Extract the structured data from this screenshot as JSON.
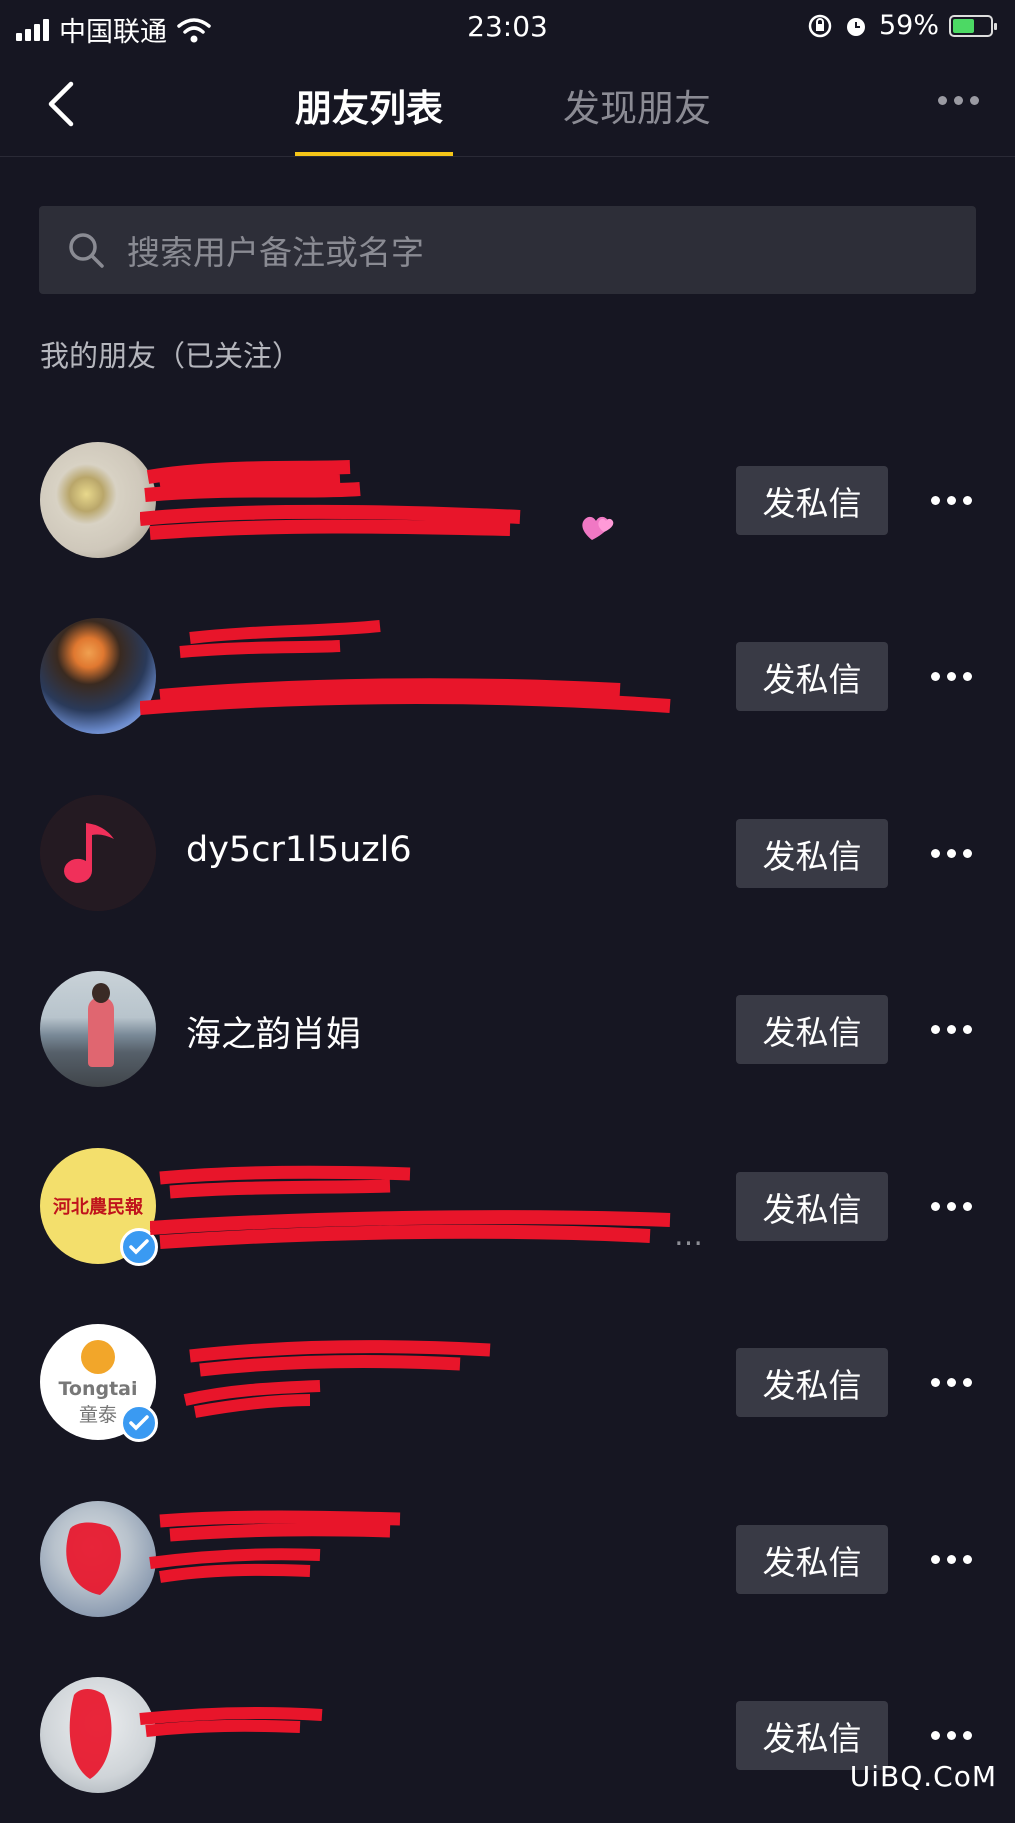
{
  "status_bar": {
    "carrier": "中国联通",
    "time": "23:03",
    "battery": "59%",
    "battery_level": 0.59
  },
  "header": {
    "tabs": [
      {
        "label": "朋友列表",
        "active": true
      },
      {
        "label": "发现朋友",
        "active": false
      }
    ],
    "accent_color": "#f5c518"
  },
  "search": {
    "placeholder": "搜索用户备注或名字"
  },
  "section_title": "我的朋友（已关注）",
  "friends": [
    {
      "name": "",
      "subtitle": "",
      "avatar": "flower-bouquet",
      "verified": false,
      "redacted": true,
      "button": "发私信"
    },
    {
      "name": "",
      "subtitle": "",
      "avatar": "flower-photo",
      "verified": false,
      "redacted": true,
      "button": "发私信"
    },
    {
      "name": "dy5cr1l5uzl6",
      "subtitle": "",
      "avatar": "music-note-icon",
      "verified": false,
      "redacted": false,
      "button": "发私信"
    },
    {
      "name": "海之韵肖娟",
      "subtitle": "",
      "avatar": "person-seaside",
      "verified": false,
      "redacted": false,
      "button": "发私信"
    },
    {
      "name": "",
      "subtitle": "…",
      "avatar": "河北农民报",
      "verified": true,
      "redacted": true,
      "button": "发私信"
    },
    {
      "name": "",
      "subtitle": "",
      "avatar_text": [
        "Tongtai",
        "童泰"
      ],
      "verified": true,
      "redacted": true,
      "button": "发私信"
    },
    {
      "name": "",
      "subtitle": "",
      "avatar": "person-photo",
      "verified": false,
      "redacted": true,
      "button": "发私信"
    },
    {
      "name": "",
      "subtitle": "",
      "avatar": "person-photo",
      "verified": false,
      "redacted": true,
      "button": "发私信"
    }
  ],
  "avatar_logos": {
    "hebei": "河北農民報"
  },
  "watermark": "UiBQ.CoM"
}
